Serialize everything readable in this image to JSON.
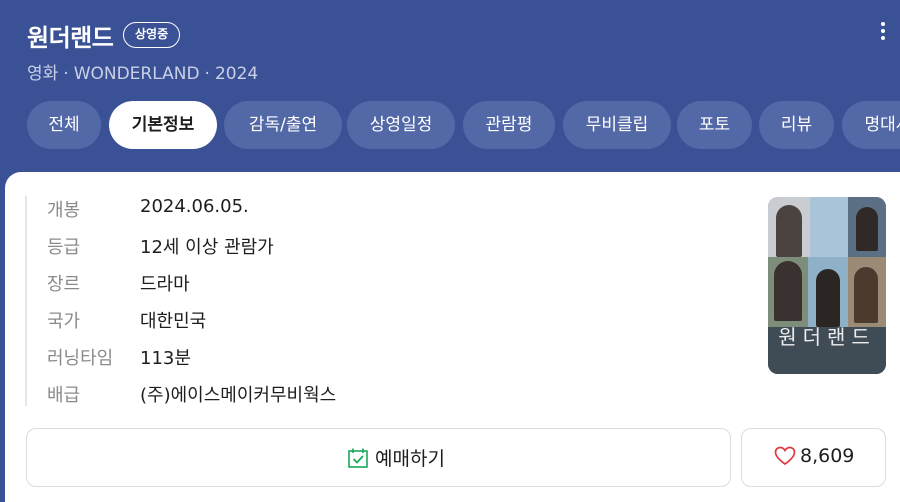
{
  "header": {
    "title": "원더랜드",
    "badge": "상영중",
    "subtitle_type": "영화",
    "subtitle_en": "WONDERLAND",
    "subtitle_year": "2024",
    "separator": "·"
  },
  "tabs": [
    {
      "label": "전체",
      "active": false
    },
    {
      "label": "기본정보",
      "active": true
    },
    {
      "label": "감독/출연",
      "active": false
    },
    {
      "label": "상영일정",
      "active": false
    },
    {
      "label": "관람평",
      "active": false
    },
    {
      "label": "무비클립",
      "active": false
    },
    {
      "label": "포토",
      "active": false
    },
    {
      "label": "리뷰",
      "active": false
    },
    {
      "label": "명대사",
      "active": false
    }
  ],
  "info": [
    {
      "key": "개봉",
      "value": "2024.06.05."
    },
    {
      "key": "등급",
      "value": "12세 이상 관람가"
    },
    {
      "key": "장르",
      "value": "드라마"
    },
    {
      "key": "국가",
      "value": "대한민국"
    },
    {
      "key": "러닝타임",
      "value": "113분"
    },
    {
      "key": "배급",
      "value": "(주)에이스메이커무비웍스"
    }
  ],
  "poster": {
    "title": "원더랜드"
  },
  "actions": {
    "reserve_label": "예매하기",
    "like_count": "8,609"
  },
  "colors": {
    "header_bg": "#3b5196",
    "tab_bg": "#5368a6",
    "check_icon": "#1aa85c",
    "heart_icon": "#e0383e"
  }
}
